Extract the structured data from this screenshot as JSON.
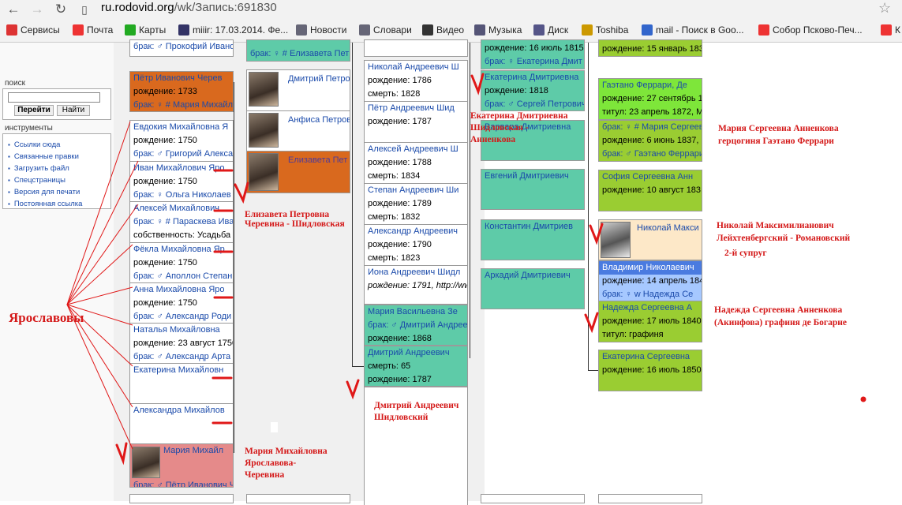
{
  "browser": {
    "url_domain": "ru.rodovid.org",
    "url_path": "/wk/Запись:691830",
    "bookmarks": [
      {
        "label": "Сервисы",
        "icon": "apps-grid-icon",
        "color": "#d33"
      },
      {
        "label": "Почта",
        "icon": "yandex-icon",
        "color": "#e33"
      },
      {
        "label": "Карты",
        "icon": "maps-icon",
        "color": "#2a2"
      },
      {
        "label": "miiir: 17.03.2014. Фе...",
        "icon": "user-icon",
        "color": "#336"
      },
      {
        "label": "Новости",
        "icon": "doc-icon",
        "color": "#667"
      },
      {
        "label": "Словари",
        "icon": "doc-icon",
        "color": "#667"
      },
      {
        "label": "Видео",
        "icon": "play-icon",
        "color": "#333"
      },
      {
        "label": "Музыка",
        "icon": "speaker-icon",
        "color": "#557"
      },
      {
        "label": "Диск",
        "icon": "mail-icon",
        "color": "#558"
      },
      {
        "label": "Toshiba",
        "icon": "folder-icon",
        "color": "#c90"
      },
      {
        "label": "mail - Поиск в Goo...",
        "icon": "google-icon",
        "color": "#36c"
      },
      {
        "label": "Собор Псково-Печ...",
        "icon": "yandex-icon",
        "color": "#e33"
      },
      {
        "label": "К",
        "icon": "yandex-icon",
        "color": "#e33"
      }
    ]
  },
  "sidebar": {
    "search_heading": "поиск",
    "go_button": "Перейти",
    "find_button": "Найти",
    "tools_heading": "инструменты",
    "tools": [
      "Ссылки сюда",
      "Связанные правки",
      "Загрузить файл",
      "Спецстраницы",
      "Версия для печати",
      "Постоянная ссылка"
    ]
  },
  "col1": {
    "c0_line1": "брак: ♂ Прокофий Иванов",
    "c1_name": "Пётр Иванович Черев",
    "c1_birth": "рождение: 1733",
    "c1_marr": "брак: ♀ # Мария Михайл",
    "c2_name": "Евдокия Михайловна Я",
    "c2_birth": "рождение: 1750",
    "c2_marr": "брак: ♂ Григорий Алекса",
    "c3_name": "Иван Михайлович Яро",
    "c3_birth": "рождение: 1750",
    "c3_marr": "брак: ♀ Ольга Николаев",
    "c4_name": "Алексей Михайлович",
    "c4_marr": "брак: ♀ # Параскева Ива",
    "c4_prop": "собственность: Усадьба",
    "c5_name": "Фёкла Михайловна Яр",
    "c5_birth": "рождение: 1750",
    "c5_marr": "брак: ♂ Аполлон Степан",
    "c6_name": "Анна Михайловна Яро",
    "c6_birth": "рождение: 1750",
    "c6_marr": "брак: ♂ Александр Роди",
    "c7_name": "Наталья Михайловна",
    "c7_birth": "рождение: 23 август 1750",
    "c7_marr": "брак: ♂ Александр Арта",
    "c8_name": "Екатерина Михайловн",
    "c9_name": "Александра Михайлов",
    "c10_name": "Мария Михайл",
    "c10_marr": "брак: ♂ Пётр Иванович Чер"
  },
  "col2": {
    "c0_line": "брак: ♀ # Елизавета Петр",
    "c1_name": "Дмитрий Петров",
    "c2_name": "Анфиса Петров",
    "c3_name": "Елизавета Пет"
  },
  "col3": {
    "a_name": "Николай Андреевич Ш",
    "a_birth": "рождение: 1786",
    "a_death": "смерть: 1828",
    "b_name": "Пётр Андреевич Шид",
    "b_birth": "рождение: 1787",
    "c_name": "Алексей Андреевич Ш",
    "c_birth": "рождение: 1788",
    "c_death": "смерть: 1834",
    "d_name": "Степан Андреевич Ши",
    "d_birth": "рождение: 1789",
    "d_death": "смерть: 1832",
    "e_name": "Александр Андреевич",
    "e_birth": "рождение: 1790",
    "e_death": "смерть: 1823",
    "f_name": "Иона Андреевич Шидл",
    "f_birth": "рождение: 1791, http://ww",
    "g_name": "Мария Васильевна Зе",
    "g_marr": "брак: ♂ Дмитрий Андрее",
    "g_birth": "рождение: 1868",
    "h_name": "Дмитрий Андреевич",
    "h_death": "смерть: 65",
    "h_birth": "рождение: 1787"
  },
  "col4": {
    "a_birth": "рождение: 16 июль 1815",
    "a_marr": "брак: ♀ Екатерина Дмит",
    "b_name": "Екатерина Дмитриевна",
    "b_birth": "рождение: 1818",
    "b_marr": "брак: ♂ Сергей Петрович",
    "c_name": "Варвара Дмитриевна",
    "d_name": "Евгений Дмитриевич",
    "e_name": "Константин Дмитриев",
    "f_name": "Аркадий Дмитриевич"
  },
  "col5": {
    "a_birth": "рождение: 15 январь 183",
    "b_name": "Гаэтано Феррари, Де",
    "b_birth": "рождение: 27 сентябрь 1",
    "b_title": "титул: 23 апрель 1872, М",
    "c_marr": "брак: ♀ # Мария Сергеевна Ан",
    "c_birth": "рождение: 6 июнь 1837, I",
    "c_marr2": "брак: ♂ Гаэтано Феррари",
    "d_name": "София Сергеевна Анн",
    "d_birth": "рождение: 10 август 183",
    "e_name": "Николай Макси",
    "f_name": "Владимир Николаевич",
    "f_birth": "рождение: 14 апрель 184",
    "f_marr": "брак: ♀ w Надежда Се",
    "g_name": "Надежда Сергеевна А",
    "g_birth": "рождение: 17 июль 1840",
    "g_title": "титул: графиня",
    "h_name": "Екатерина Сергеевна",
    "h_birth": "рождение: 16 июль 1850"
  },
  "annotations": {
    "yaroslavovy": "Ярославовы",
    "elizaveta": [
      "Елизавета  Петровна",
      "Черевина - Шидловская"
    ],
    "maria_yar": [
      "Мария Михайловна",
      "Ярославова-",
      "Черевина"
    ],
    "dmitry": [
      "Дмитрий  Андреевич",
      "Шидловский"
    ],
    "ekaterina": [
      "Екатерина Дмитриевна",
      "Шидловская -",
      "Анненкова"
    ],
    "maria_ann": [
      "Мария  Сергеевна  Анненкова",
      "герцогиня  Гаэтано  Феррари"
    ],
    "nikolai": [
      "Николай Максимилианович",
      "Лейхтенбергский - Романовский"
    ],
    "second": "2-й супруг",
    "nadezhda": [
      "Надежда  Сергеевна  Анненкова",
      "(Акинфова)  графиня  де Богарне"
    ]
  }
}
